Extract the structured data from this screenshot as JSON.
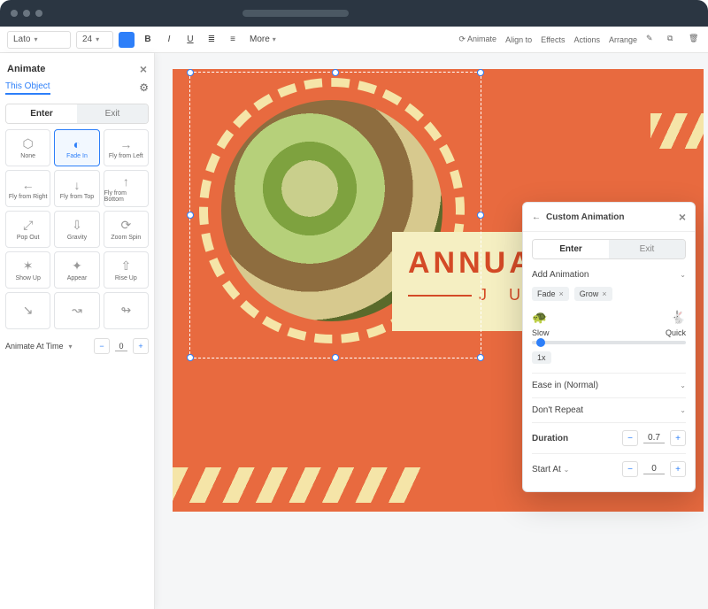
{
  "chrome": {
    "dots": 3
  },
  "toolbar": {
    "font": "Lato",
    "size": "24",
    "bold": "B",
    "italic": "I",
    "underline": "U",
    "more": "More",
    "right": {
      "animate": "Animate",
      "align": "Align to",
      "effects": "Effects",
      "actions": "Actions",
      "arrange": "Arrange"
    }
  },
  "panel": {
    "title": "Animate",
    "object_tag": "This Object",
    "tabs": {
      "enter": "Enter",
      "exit": "Exit"
    },
    "options": [
      {
        "label": "None",
        "icon": "⬡"
      },
      {
        "label": "Fade In",
        "icon": "◐",
        "selected": true
      },
      {
        "label": "Fly from Left",
        "icon": "→"
      },
      {
        "label": "Fly from Right",
        "icon": "←"
      },
      {
        "label": "Fly from Top",
        "icon": "↓"
      },
      {
        "label": "Fly from Bottom",
        "icon": "↑"
      },
      {
        "label": "Pop Out",
        "icon": "⤢"
      },
      {
        "label": "Gravity",
        "icon": "⇩"
      },
      {
        "label": "Zoom Spin",
        "icon": "⟳"
      },
      {
        "label": "Show Up",
        "icon": "✶"
      },
      {
        "label": "Appear",
        "icon": "✦"
      },
      {
        "label": "Rise Up",
        "icon": "⇧"
      },
      {
        "label": "",
        "icon": "↘"
      },
      {
        "label": "",
        "icon": "↝"
      },
      {
        "label": "",
        "icon": "↬"
      }
    ],
    "timing": {
      "label": "Animate At Time",
      "value": "0"
    }
  },
  "canvas": {
    "headline": "ANNUAL I",
    "subline": "J U N E"
  },
  "float": {
    "title": "Custom Animation",
    "tabs": {
      "enter": "Enter",
      "exit": "Exit"
    },
    "add": "Add Animation",
    "chips": [
      "Fade",
      "Grow"
    ],
    "speed": {
      "slow": "Slow",
      "quick": "Quick",
      "mult": "1x"
    },
    "easing": "Ease in (Normal)",
    "repeat": "Don't Repeat",
    "duration": {
      "label": "Duration",
      "value": "0.7"
    },
    "startat": {
      "label": "Start At",
      "value": "0"
    }
  }
}
